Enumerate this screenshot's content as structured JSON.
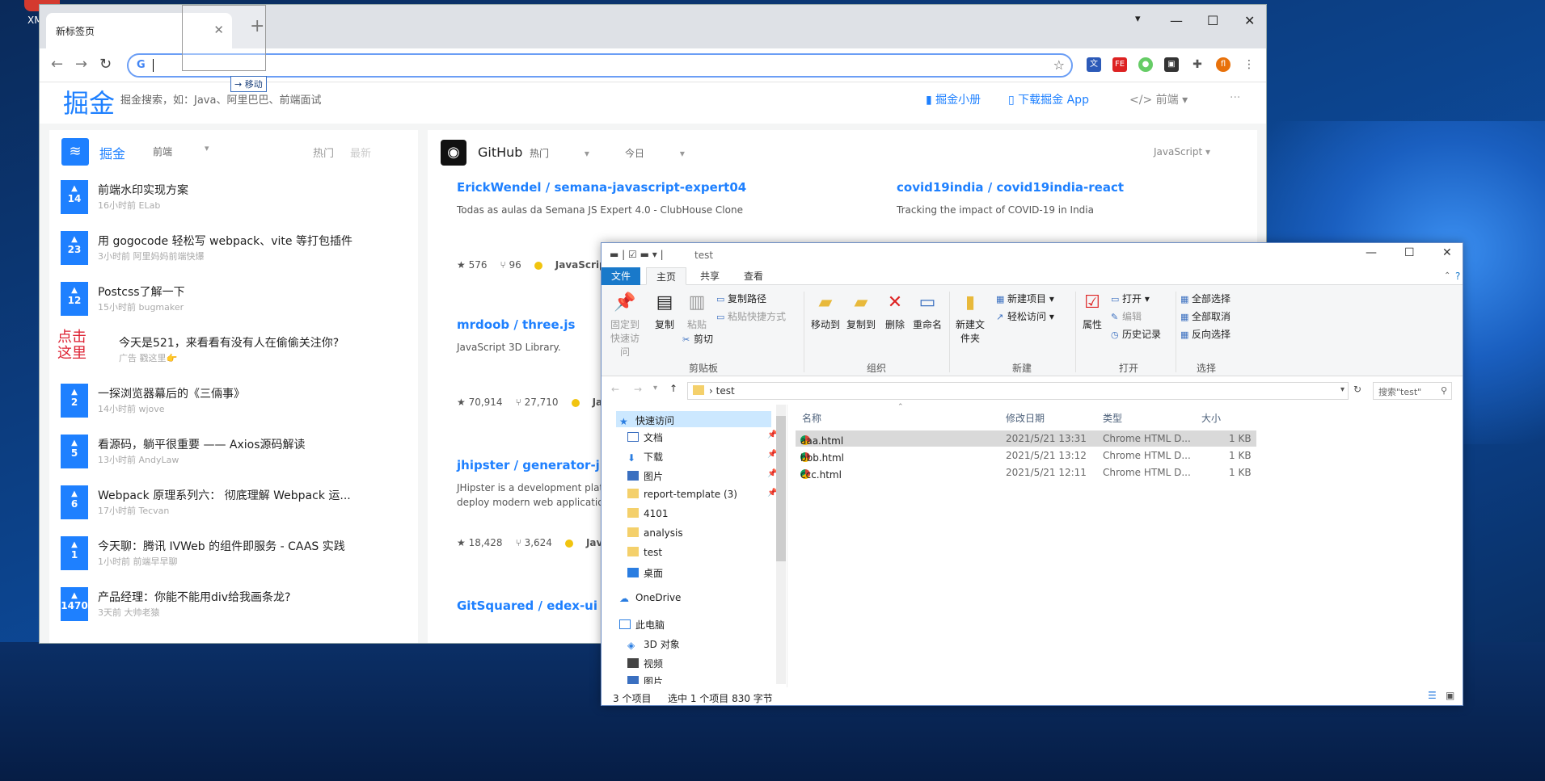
{
  "desktop": {
    "icon_label": "XM"
  },
  "browser": {
    "tab_title": "新标签页",
    "address_value": "",
    "move_tip": "→ 移动",
    "win_controls": {
      "minimize": "—",
      "maximize": "☐",
      "close": "✕"
    }
  },
  "juejin": {
    "logo": "掘金",
    "search_placeholder": "掘金搜索，如：Java、阿里巴巴、前端面试",
    "header_links": [
      "掘金小册",
      "下载掘金 App"
    ],
    "header_select": "前端",
    "left": {
      "name": "掘金",
      "category": "前端",
      "tabs": [
        "热门",
        "最新"
      ],
      "items": [
        {
          "votes": "14",
          "title": "前端水印实现方案",
          "meta": "16小时前   ELab"
        },
        {
          "votes": "23",
          "title": "用 gogocode 轻松写 webpack、vite 等打包插件",
          "meta": "3小时前   阿里妈妈前端快爆"
        },
        {
          "votes": "12",
          "title": "Postcss了解一下",
          "meta": "15小时前   bugmaker"
        },
        {
          "votes": "",
          "title": "今天是521，来看看有没有人在偷偷关注你?",
          "meta": "广告   戳这里👉",
          "ad": "点击这里"
        },
        {
          "votes": "2",
          "title": "一探浏览器幕后的《三倆事》",
          "meta": "14小时前   wjove"
        },
        {
          "votes": "5",
          "title": "看源码，躺平很重要 —— Axios源码解读",
          "meta": "13小时前   AndyLaw"
        },
        {
          "votes": "6",
          "title": "Webpack 原理系列六： 彻底理解 Webpack 运...",
          "meta": "17小时前   Tecvan"
        },
        {
          "votes": "1",
          "title": "今天聊：腾讯 IVWeb 的组件即服务 - CAAS 实践",
          "meta": "1小时前   前端早早聊"
        },
        {
          "votes": "1470",
          "title": "产品经理：你能不能用div给我画条龙?",
          "meta": "3天前   大帅老猿"
        }
      ]
    },
    "github": {
      "name": "GitHub",
      "sort": "热门",
      "period": "今日",
      "language": "JavaScript",
      "repos": [
        {
          "name": "ErickWendel / semana-javascript-expert04",
          "desc": "Todas as aulas da Semana JS Expert 4.0 - ClubHouse Clone",
          "stars": "★ 576",
          "forks": "⑂ 96",
          "lang": "JavaScript"
        },
        {
          "name": "covid19india / covid19india-react",
          "desc": "Tracking the impact of COVID-19 in India",
          "stars": "",
          "forks": "",
          "lang": ""
        },
        {
          "name": "mrdoob / three.js",
          "desc": "JavaScript 3D Library.",
          "stars": "★ 70,914",
          "forks": "⑂ 27,710",
          "lang": "JavaS"
        },
        {
          "name": "jhipster / generator-jhipster",
          "desc": "JHipster is a development platform t deploy modern web applications & r",
          "stars": "★ 18,428",
          "forks": "⑂ 3,624",
          "lang": "JavaSc"
        },
        {
          "name": "GitSquared / edex-ui",
          "desc": "",
          "stars": "",
          "forks": "",
          "lang": ""
        }
      ]
    }
  },
  "explorer": {
    "title": "test",
    "tabs": [
      "文件",
      "主页",
      "共享",
      "查看"
    ],
    "ribbon": {
      "pin": "固定到快速访问",
      "copy": "复制",
      "paste": "粘贴",
      "copy_path": "复制路径",
      "paste_shortcut": "粘贴快捷方式",
      "cut": "剪切",
      "move_to": "移动到",
      "copy_to": "复制到",
      "delete": "删除",
      "rename": "重命名",
      "new_folder": "新建文件夹",
      "new_item": "新建项目",
      "easy_access": "轻松访问",
      "properties": "属性",
      "open": "打开",
      "edit": "编辑",
      "history": "历史记录",
      "select_all": "全部选择",
      "select_none": "全部取消",
      "invert": "反向选择",
      "groups": [
        "剪贴板",
        "组织",
        "新建",
        "打开",
        "选择"
      ]
    },
    "breadcrumb": "test",
    "search_placeholder": "搜索\"test\"",
    "nav": [
      "快速访问",
      "文档",
      "下载",
      "图片",
      "report-template (3)",
      "4101",
      "analysis",
      "test",
      "桌面",
      "OneDrive",
      "此电脑",
      "3D 对象",
      "视频",
      "图片"
    ],
    "columns": [
      "名称",
      "修改日期",
      "类型",
      "大小"
    ],
    "files": [
      {
        "name": "aaa.html",
        "date": "2021/5/21 13:31",
        "type": "Chrome HTML D...",
        "size": "1 KB"
      },
      {
        "name": "bbb.html",
        "date": "2021/5/21 13:12",
        "type": "Chrome HTML D...",
        "size": "1 KB"
      },
      {
        "name": "ccc.html",
        "date": "2021/5/21 12:11",
        "type": "Chrome HTML D...",
        "size": "1 KB"
      }
    ],
    "status": {
      "count": "3 个项目",
      "selected": "选中 1 个项目  830 字节"
    }
  }
}
